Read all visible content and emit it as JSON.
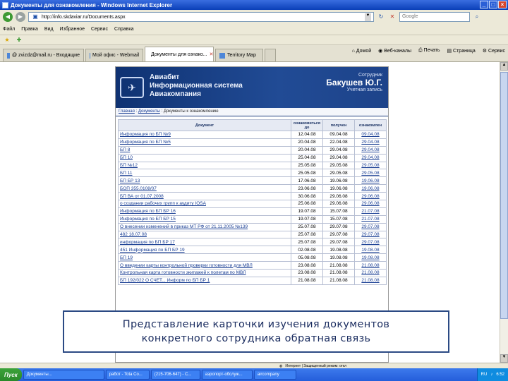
{
  "window": {
    "title": "Документы для ознакомления - Windows Internet Explorer"
  },
  "address": {
    "url": "http://info.skdaviar.ru/Documents.aspx",
    "search_placeholder": "Google"
  },
  "menu": [
    "Файл",
    "Правка",
    "Вид",
    "Избранное",
    "Сервис",
    "Справка"
  ],
  "tabs": [
    {
      "label": "@ zvizdz@mail.ru - Входящие",
      "active": false
    },
    {
      "label": "Мой офис - Webmail",
      "active": false
    },
    {
      "label": "Документы для ознако...",
      "active": true
    },
    {
      "label": "Territory Map",
      "active": false
    }
  ],
  "commands": [
    "Домой",
    "Веб-каналы",
    "Печать",
    "Страница",
    "Сервис"
  ],
  "header": {
    "system_name_line1": "Авиабит",
    "system_name_line2": "Информационная система",
    "system_name_line3": "Авиакомпания",
    "user_role": "Сотрудник",
    "user_name": "Бакушев Ю.Г.",
    "account_label": "Учетная запись"
  },
  "breadcrumb": {
    "home": "Главная",
    "section": "Документы",
    "current": "Документы к ознакомлению"
  },
  "table": {
    "columns": [
      "Документ",
      "ознакомиться до",
      "получен",
      "ознакомлен"
    ],
    "rows": [
      [
        "Информация по БП №9",
        "12.04.08",
        "09.04.08",
        "09.04.08"
      ],
      [
        "Информация по БП №5",
        "20.04.08",
        "22.04.08",
        "29.04.08"
      ],
      [
        "БП 8",
        "20.04.08",
        "29.04.08",
        "29.04.08"
      ],
      [
        "БП 10",
        "25.04.08",
        "29.04.08",
        "29.04.08"
      ],
      [
        "БП №12",
        "25.05.08",
        "29.05.08",
        "29.05.08"
      ],
      [
        "БП 11",
        "25.05.08",
        "29.05.08",
        "29.05.08"
      ],
      [
        "БП БР 13",
        "17.06.08",
        "19.06.08",
        "19.06.08"
      ],
      [
        "БОП 355.0108/07",
        "23.06.08",
        "19.06.08",
        "19.06.08"
      ],
      [
        "БП ВА от 01.07.2008",
        "30.06.08",
        "29.06.08",
        "29.06.08"
      ],
      [
        "о создании рабочих групп к аудиту IOSA",
        "25.06.08",
        "29.06.08",
        "29.06.08"
      ],
      [
        "Информация по БП БР 16",
        "19.07.08",
        "15.07.08",
        "21.07.08"
      ],
      [
        "Информация по БП БР 15",
        "19.07.08",
        "15.07.08",
        "21.07.08"
      ],
      [
        "О внесении изменений в приказ МТ РФ от 21.11.2005 №139",
        "25.07.08",
        "29.07.08",
        "29.07.08"
      ],
      [
        "482 18.07.08",
        "25.07.08",
        "29.07.08",
        "29.07.08"
      ],
      [
        "информация по БП БР 17",
        "25.07.08",
        "29.07.08",
        "29.07.08"
      ],
      [
        "451 Информация по БП БР 19",
        "02.08.08",
        "19.08.08",
        "19.08.08"
      ],
      [
        "БП 19",
        "05.08.08",
        "19.08.08",
        "19.08.08"
      ],
      [
        "О введении карты контрольной проверки готовности для МВЛ",
        "23.08.08",
        "21.08.08",
        "21.08.08"
      ],
      [
        "Контрольная карта готовности экипажей к полетам по МВЛ",
        "23.08.08",
        "21.08.08",
        "21.08.08"
      ],
      [
        "БП 192/022 О СЧЕТ... Информ по БП БР 1",
        "21.08.08",
        "21.08.08",
        "21.08.08"
      ]
    ]
  },
  "caption": {
    "line1": "Представление карточки изучения документов",
    "line2": "конкретного сотрудника обратная связь"
  },
  "statusbar": {
    "zone": "Интернет | Защищенный режим: откл"
  },
  "taskbar": {
    "start": "Пуск",
    "tasks": [
      "Документы...",
      "работ - Tota Co...",
      "(215-706-647) - C...",
      "аэропорт-обслуж...",
      "aircompany"
    ],
    "lang": "RU",
    "clock": "6:52"
  }
}
